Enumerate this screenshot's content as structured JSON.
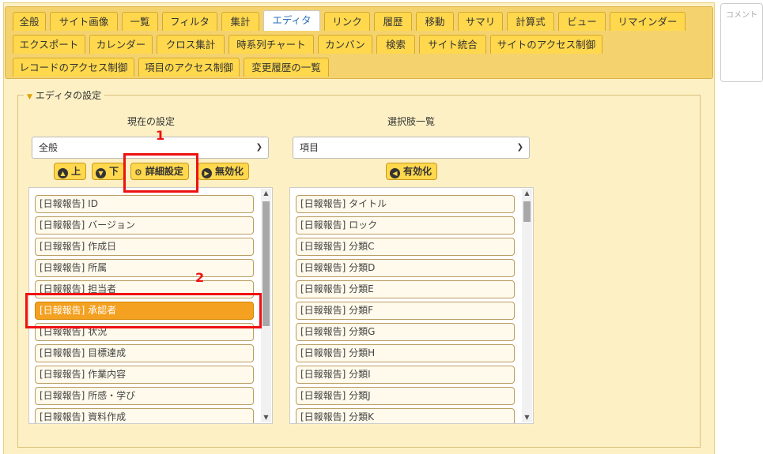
{
  "tabs": {
    "row1": [
      "全般",
      "サイト画像",
      "一覧",
      "フィルタ",
      "集計",
      "エディタ",
      "リンク",
      "履歴",
      "移動",
      "サマリ",
      "計算式",
      "ビュー",
      "リマインダー"
    ],
    "row2": [
      "エクスポート",
      "カレンダー",
      "クロス集計",
      "時系列チャート",
      "カンバン",
      "検索",
      "サイト統合",
      "サイトのアクセス制御"
    ],
    "row3": [
      "レコードのアクセス制御",
      "項目のアクセス制御",
      "変更履歴の一覧"
    ],
    "active": "エディタ"
  },
  "comment": {
    "placeholder": "コメント"
  },
  "editor_settings": {
    "legend": "エディタの設定",
    "current": {
      "heading": "現在の設定",
      "select_value": "全般",
      "buttons": {
        "up": "上",
        "down": "下",
        "details": "詳細設定",
        "disable": "無効化"
      },
      "items": [
        "[日報報告] ID",
        "[日報報告] バージョン",
        "[日報報告] 作成日",
        "[日報報告] 所属",
        "[日報報告] 担当者",
        "[日報報告] 承認者",
        "[日報報告] 状況",
        "[日報報告] 目標達成",
        "[日報報告] 作業内容",
        "[日報報告] 所感・学び",
        "[日報報告] 資料作成"
      ],
      "selected": "[日報報告] 承認者"
    },
    "choices": {
      "heading": "選択肢一覧",
      "select_value": "項目",
      "buttons": {
        "enable": "有効化"
      },
      "items": [
        "[日報報告] タイトル",
        "[日報報告] ロック",
        "[日報報告] 分類C",
        "[日報報告] 分類D",
        "[日報報告] 分類E",
        "[日報報告] 分類F",
        "[日報報告] 分類G",
        "[日報報告] 分類H",
        "[日報報告] 分類I",
        "[日報報告] 分類J",
        "[日報報告] 分類K"
      ]
    }
  },
  "annotations": {
    "label1": "1",
    "label2": "2",
    "color": "#ee1111"
  },
  "colors": {
    "tab_bg": "#ffd84d",
    "panel_bg": "#fdf0c4",
    "selected_item": "#f4a020",
    "active_tab_text": "#2a6fb8"
  }
}
